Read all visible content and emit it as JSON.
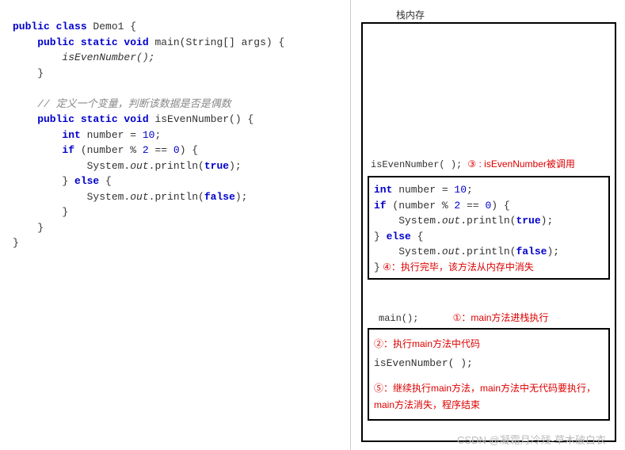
{
  "code": {
    "l1_kw1": "public class",
    "l1_cls": " Demo1 {",
    "l2_kw": "    public static void",
    "l2_sig": " main(String[] args) {",
    "l3": "        isEvenNumber();",
    "l4": "    }",
    "blank": "",
    "l6_comment": "    // 定义一个变量，判断该数据是否是偶数",
    "l7_kw": "    public static void",
    "l7_sig": " isEvenNumber() {",
    "l8_kw": "        int",
    "l8_rest": " number = ",
    "l8_num": "10",
    "l8_end": ";",
    "l9_kw": "        if ",
    "l9_open": "(number % ",
    "l9_n2": "2",
    "l9_mid": " == ",
    "l9_n0": "0",
    "l9_close": ") {",
    "l10_a": "            System.",
    "l10_out": "out",
    "l10_b": ".println(",
    "l10_true": "true",
    "l10_c": ");",
    "l11_a": "        } ",
    "l11_else": "else",
    "l11_b": " {",
    "l12_a": "            System.",
    "l12_out": "out",
    "l12_b": ".println(",
    "l12_false": "false",
    "l12_c": ");",
    "l13": "        }",
    "l14": "    }",
    "l15": "}"
  },
  "stack": {
    "title": "栈内存",
    "call1_code": "isEvenNumber( );",
    "note3": "③ : isEvenNumber被调用",
    "frame1": {
      "l1_kw": "int",
      "l1_rest": " number = ",
      "l1_num": "10",
      "l1_end": ";",
      "l2_kw": "if ",
      "l2_open": "(number % ",
      "l2_n2": "2",
      "l2_mid": " == ",
      "l2_n0": "0",
      "l2_close": ") {",
      "l3_a": "    System.",
      "l3_out": "out",
      "l3_b": ".println(",
      "l3_true": "true",
      "l3_c": ");",
      "l4_a": "} ",
      "l4_else": "else",
      "l4_b": " {",
      "l5_a": "    System.",
      "l5_out": "out",
      "l5_b": ".println(",
      "l5_false": "false",
      "l5_c": ");",
      "l6": "}",
      "note4": "  ④：执行完毕，该方法从内存中消失"
    },
    "main_label": "main();",
    "note1": "①：main方法进栈执行",
    "frame2": {
      "note2": "②：执行main方法中代码",
      "code": "isEvenNumber( );",
      "note5": "⑤：继续执行main方法，main方法中无代码要执行，main方法消失，程序结束"
    }
  },
  "watermark": "CSDN @凝霜月冷残-草木破白衣"
}
